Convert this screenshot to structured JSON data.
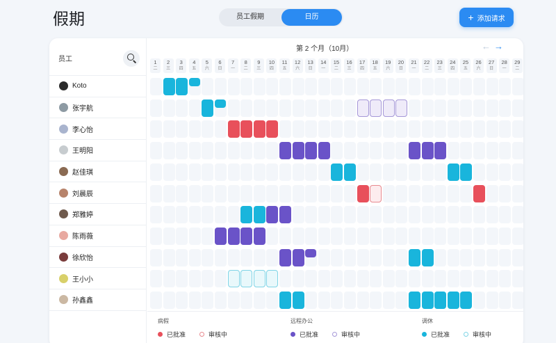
{
  "header": {
    "title": "假期",
    "tabs": [
      {
        "label": "员工假期",
        "active": false
      },
      {
        "label": "日历",
        "active": true
      }
    ],
    "add_label": "添加请求"
  },
  "sidebar": {
    "header_label": "员工",
    "employees": [
      {
        "name": "Koto",
        "avatar": "#2a2a2a"
      },
      {
        "name": "张宇航",
        "avatar": "#8d9aa3"
      },
      {
        "name": "李心怡",
        "avatar": "#a9b4ce"
      },
      {
        "name": "王明阳",
        "avatar": "#c7cccf"
      },
      {
        "name": "赵佳琪",
        "avatar": "#8a6a52"
      },
      {
        "name": "刘晨辰",
        "avatar": "#b7836b"
      },
      {
        "name": "郑雅婷",
        "avatar": "#6f5a4d"
      },
      {
        "name": "陈雨薇",
        "avatar": "#e8a9a0"
      },
      {
        "name": "徐欣怡",
        "avatar": "#7a3c3c"
      },
      {
        "name": "王小小",
        "avatar": "#d8d06a"
      },
      {
        "name": "孙鑫鑫",
        "avatar": "#cbb8a3"
      }
    ]
  },
  "calendar": {
    "month_title": "第 2 个月（10月）",
    "days": [
      {
        "d": "1",
        "w": "二"
      },
      {
        "d": "2",
        "w": "三"
      },
      {
        "d": "3",
        "w": "四"
      },
      {
        "d": "4",
        "w": "五"
      },
      {
        "d": "5",
        "w": "六"
      },
      {
        "d": "6",
        "w": "日"
      },
      {
        "d": "7",
        "w": "一"
      },
      {
        "d": "8",
        "w": "二"
      },
      {
        "d": "9",
        "w": "三"
      },
      {
        "d": "10",
        "w": "四"
      },
      {
        "d": "11",
        "w": "五"
      },
      {
        "d": "12",
        "w": "六"
      },
      {
        "d": "13",
        "w": "日"
      },
      {
        "d": "14",
        "w": "一"
      },
      {
        "d": "15",
        "w": "二"
      },
      {
        "d": "16",
        "w": "三"
      },
      {
        "d": "17",
        "w": "四"
      },
      {
        "d": "18",
        "w": "五"
      },
      {
        "d": "19",
        "w": "六"
      },
      {
        "d": "20",
        "w": "日"
      },
      {
        "d": "21",
        "w": "一"
      },
      {
        "d": "22",
        "w": "二"
      },
      {
        "d": "23",
        "w": "三"
      },
      {
        "d": "24",
        "w": "四"
      },
      {
        "d": "25",
        "w": "五"
      },
      {
        "d": "26",
        "w": "六"
      },
      {
        "d": "27",
        "w": "日"
      },
      {
        "d": "28",
        "w": "一"
      },
      {
        "d": "29",
        "w": "二"
      }
    ],
    "entries": [
      {
        "emp": 0,
        "day": 2,
        "type": "comp",
        "status": "approved"
      },
      {
        "emp": 0,
        "day": 3,
        "type": "comp",
        "status": "approved"
      },
      {
        "emp": 0,
        "day": 4,
        "type": "comp",
        "status": "approved",
        "half": true
      },
      {
        "emp": 1,
        "day": 5,
        "type": "comp",
        "status": "approved"
      },
      {
        "emp": 1,
        "day": 6,
        "type": "comp",
        "status": "approved",
        "half": true
      },
      {
        "emp": 1,
        "day": 17,
        "type": "remote",
        "status": "pending"
      },
      {
        "emp": 1,
        "day": 18,
        "type": "remote",
        "status": "pending"
      },
      {
        "emp": 1,
        "day": 19,
        "type": "remote",
        "status": "pending"
      },
      {
        "emp": 1,
        "day": 20,
        "type": "remote",
        "status": "pending"
      },
      {
        "emp": 2,
        "day": 7,
        "type": "sick",
        "status": "approved"
      },
      {
        "emp": 2,
        "day": 8,
        "type": "sick",
        "status": "approved"
      },
      {
        "emp": 2,
        "day": 9,
        "type": "sick",
        "status": "approved"
      },
      {
        "emp": 2,
        "day": 10,
        "type": "sick",
        "status": "approved"
      },
      {
        "emp": 3,
        "day": 11,
        "type": "remote",
        "status": "approved"
      },
      {
        "emp": 3,
        "day": 12,
        "type": "remote",
        "status": "approved"
      },
      {
        "emp": 3,
        "day": 13,
        "type": "remote",
        "status": "approved"
      },
      {
        "emp": 3,
        "day": 14,
        "type": "remote",
        "status": "approved"
      },
      {
        "emp": 3,
        "day": 21,
        "type": "remote",
        "status": "approved"
      },
      {
        "emp": 3,
        "day": 22,
        "type": "remote",
        "status": "approved"
      },
      {
        "emp": 3,
        "day": 23,
        "type": "remote",
        "status": "approved"
      },
      {
        "emp": 4,
        "day": 15,
        "type": "comp",
        "status": "approved"
      },
      {
        "emp": 4,
        "day": 16,
        "type": "comp",
        "status": "approved"
      },
      {
        "emp": 4,
        "day": 24,
        "type": "comp",
        "status": "approved"
      },
      {
        "emp": 4,
        "day": 25,
        "type": "comp",
        "status": "approved"
      },
      {
        "emp": 5,
        "day": 17,
        "type": "sick",
        "status": "approved"
      },
      {
        "emp": 5,
        "day": 18,
        "type": "sick",
        "status": "pending"
      },
      {
        "emp": 5,
        "day": 26,
        "type": "sick",
        "status": "approved"
      },
      {
        "emp": 6,
        "day": 8,
        "type": "comp",
        "status": "approved"
      },
      {
        "emp": 6,
        "day": 9,
        "type": "comp",
        "status": "approved"
      },
      {
        "emp": 6,
        "day": 10,
        "type": "remote",
        "status": "approved"
      },
      {
        "emp": 6,
        "day": 11,
        "type": "remote",
        "status": "approved"
      },
      {
        "emp": 7,
        "day": 6,
        "type": "remote",
        "status": "approved"
      },
      {
        "emp": 7,
        "day": 7,
        "type": "remote",
        "status": "approved"
      },
      {
        "emp": 7,
        "day": 8,
        "type": "remote",
        "status": "approved"
      },
      {
        "emp": 7,
        "day": 9,
        "type": "remote",
        "status": "approved"
      },
      {
        "emp": 8,
        "day": 11,
        "type": "remote",
        "status": "approved"
      },
      {
        "emp": 8,
        "day": 12,
        "type": "remote",
        "status": "approved"
      },
      {
        "emp": 8,
        "day": 13,
        "type": "remote",
        "status": "approved",
        "half": true
      },
      {
        "emp": 8,
        "day": 21,
        "type": "comp",
        "status": "approved"
      },
      {
        "emp": 8,
        "day": 22,
        "type": "comp",
        "status": "approved"
      },
      {
        "emp": 9,
        "day": 7,
        "type": "comp",
        "status": "pending"
      },
      {
        "emp": 9,
        "day": 8,
        "type": "comp",
        "status": "pending"
      },
      {
        "emp": 9,
        "day": 9,
        "type": "comp",
        "status": "pending"
      },
      {
        "emp": 9,
        "day": 10,
        "type": "comp",
        "status": "pending"
      },
      {
        "emp": 10,
        "day": 11,
        "type": "comp",
        "status": "approved"
      },
      {
        "emp": 10,
        "day": 12,
        "type": "comp",
        "status": "approved"
      },
      {
        "emp": 10,
        "day": 21,
        "type": "comp",
        "status": "approved"
      },
      {
        "emp": 10,
        "day": 22,
        "type": "comp",
        "status": "approved"
      },
      {
        "emp": 10,
        "day": 23,
        "type": "comp",
        "status": "approved"
      },
      {
        "emp": 10,
        "day": 24,
        "type": "comp",
        "status": "approved"
      },
      {
        "emp": 10,
        "day": 25,
        "type": "comp",
        "status": "approved"
      }
    ]
  },
  "legend": {
    "groups": [
      {
        "key": "sick",
        "title": "病假",
        "approved": "已批准",
        "pending": "审核中"
      },
      {
        "key": "remote",
        "title": "远程办公",
        "approved": "已批准",
        "pending": "审核中"
      },
      {
        "key": "comp",
        "title": "调休",
        "approved": "已批准",
        "pending": "审核中"
      }
    ]
  },
  "colors": {
    "accent": "#2b8bf2",
    "sick": {
      "fill": "#e8505b",
      "pending_fill": "#fdecee",
      "pending_border": "#e8898f"
    },
    "remote": {
      "fill": "#6a53c8",
      "pending_fill": "#efebf9",
      "pending_border": "#a597d8"
    },
    "comp": {
      "fill": "#19b5dc",
      "pending_fill": "#e9f8fb",
      "pending_border": "#7fd4e6"
    }
  }
}
